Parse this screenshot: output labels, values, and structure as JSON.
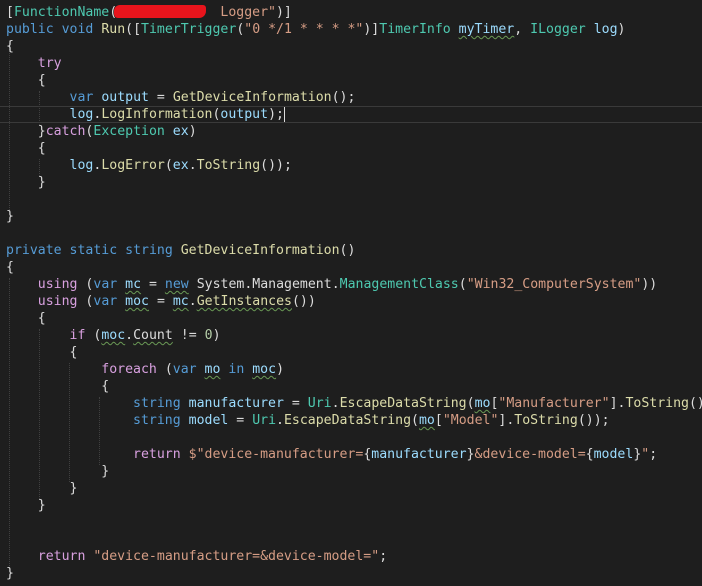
{
  "editor": {
    "lines": [
      "[FunctionName(\"            Logger\")]",
      "public void Run([TimerTrigger(\"0 */1 * * * *\")]TimerInfo myTimer, ILogger log)",
      "{",
      "    try",
      "    {",
      "        var output = GetDeviceInformation();",
      "        log.LogInformation(output);",
      "    }catch(Exception ex)",
      "    {",
      "        log.LogError(ex.ToString());",
      "    }",
      "",
      "}",
      "",
      "private static string GetDeviceInformation()",
      "{",
      "    using (var mc = new System.Management.ManagementClass(\"Win32_ComputerSystem\"))",
      "    using (var moc = mc.GetInstances())",
      "    {",
      "        if (moc.Count != 0)",
      "        {",
      "            foreach (var mo in moc)",
      "            {",
      "                string manufacturer = Uri.EscapeDataString(mo[\"Manufacturer\"].ToString());",
      "                string model = Uri.EscapeDataString(mo[\"Model\"].ToString());",
      "",
      "                return $\"device-manufacturer={manufacturer}&device-model={model}\";",
      "            }",
      "        }",
      "    }",
      "",
      "",
      "    return \"device-manufacturer=&device-model=\";",
      "}"
    ]
  },
  "colors": {
    "background": "#1e1e1e",
    "keyword": "#569cd6",
    "control": "#d8a0df",
    "type": "#4ec9b0",
    "method": "#dcdcaa",
    "string": "#d69d85",
    "number": "#b5cea8",
    "parameter": "#9cdcfe",
    "redaction": "#e8141c"
  }
}
